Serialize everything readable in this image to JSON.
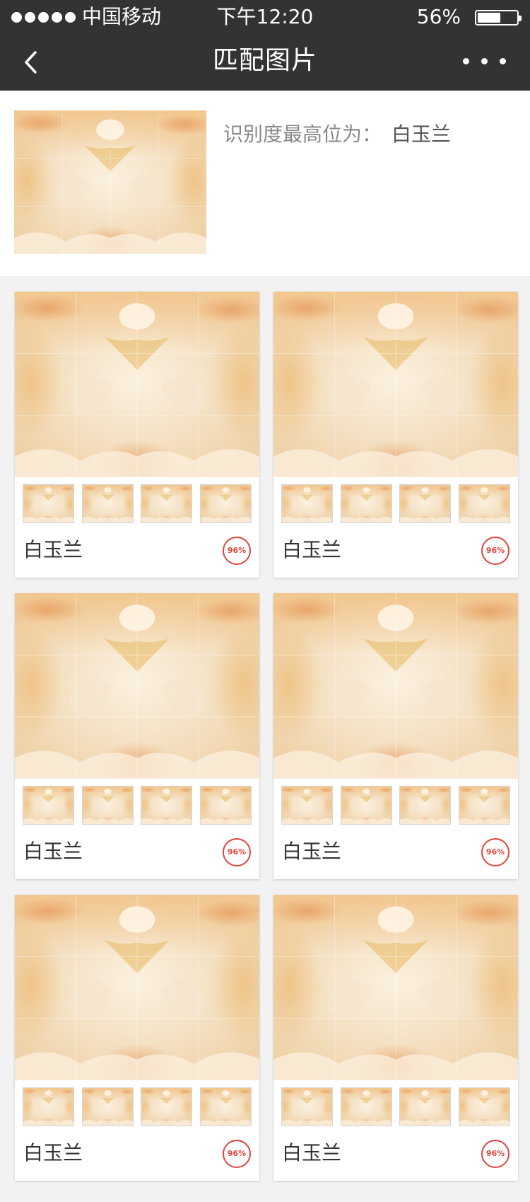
{
  "status_bar": {
    "carrier": "中国移动",
    "time": "下午12:20",
    "battery_percent": "56%"
  },
  "nav": {
    "title": "匹配图片"
  },
  "summary": {
    "label": "识别度最高位为：",
    "value": "白玉兰"
  },
  "results": [
    {
      "name": "白玉兰",
      "score": "96%"
    },
    {
      "name": "白玉兰",
      "score": "96%"
    },
    {
      "name": "白玉兰",
      "score": "96%"
    },
    {
      "name": "白玉兰",
      "score": "96%"
    },
    {
      "name": "白玉兰",
      "score": "96%"
    },
    {
      "name": "白玉兰",
      "score": "96%"
    }
  ],
  "colors": {
    "header_bg": "#333333",
    "badge_red": "#e0453d",
    "page_bg": "#f2f2f2"
  },
  "icons": [
    "back-chevron-icon",
    "more-dots-icon",
    "battery-icon",
    "signal-dots-icon"
  ]
}
